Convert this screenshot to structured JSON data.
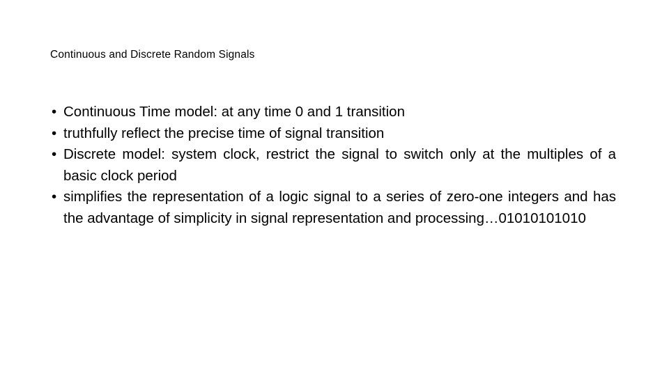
{
  "slide": {
    "title": "Continuous and Discrete Random Signals",
    "background_color": "#ffffff",
    "text_color": "#000000",
    "bullet_glyph": "•",
    "bullets": [
      {
        "text": "Continuous Time model: at any time 0 and 1 transition",
        "wrapped": false
      },
      {
        "text": "truthfully reflect the precise time of signal transition",
        "wrapped": false
      },
      {
        "text": "Discrete model: system clock, restrict the signal to switch only at the multiples of a basic clock period",
        "wrapped": true
      },
      {
        "text": "simplifies the representation of a logic signal to a series of zero-one integers and has the advantage of simplicity in signal representation and processing…01010101010",
        "wrapped": true
      }
    ]
  }
}
